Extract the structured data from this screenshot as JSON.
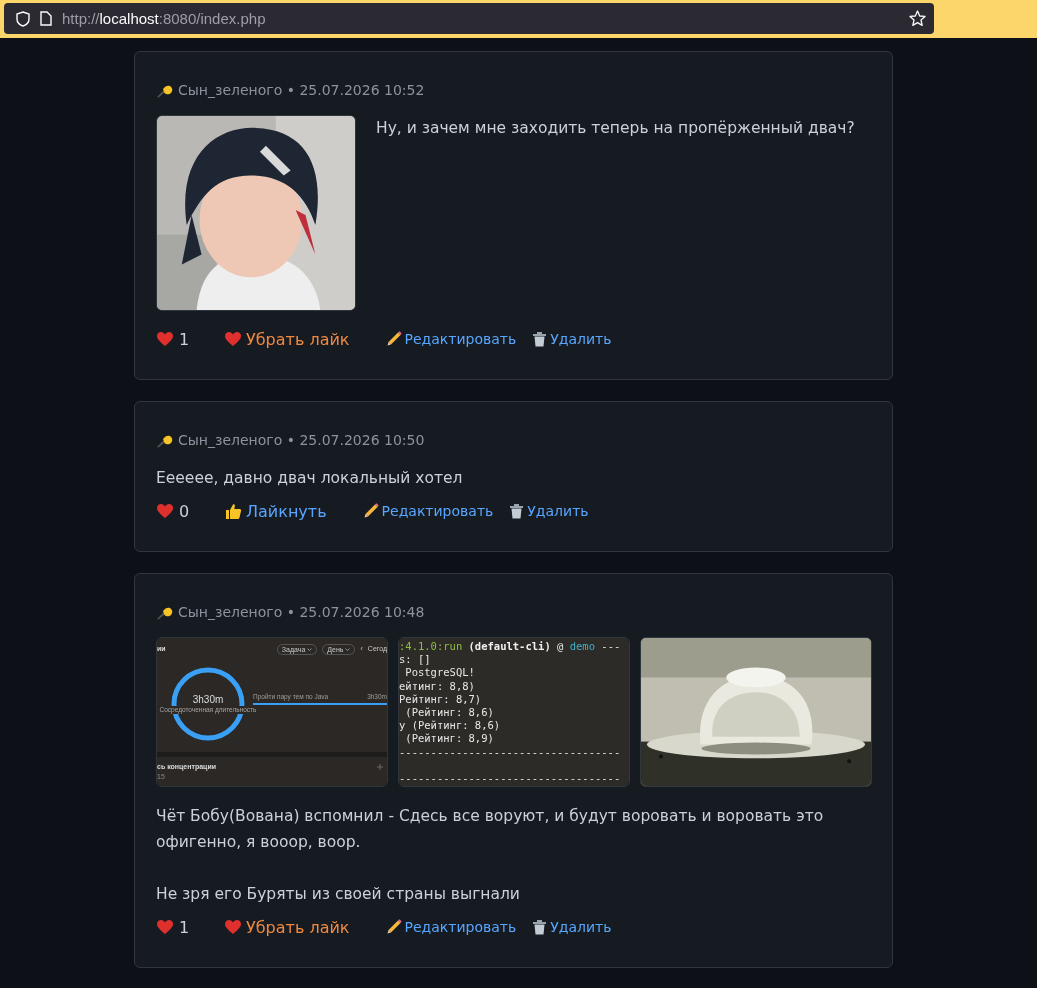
{
  "browser": {
    "url_scheme": "http://",
    "url_host": "localhost",
    "url_rest": ":8080/index.php"
  },
  "posts": [
    {
      "meta": "Сын_зеленого • 25.07.2026 10:52",
      "media": [
        {
          "kind": "picture"
        }
      ],
      "paragraphs": [
        "Ну, и зачем мне заходить теперь на пропёрженный двач?"
      ],
      "likes": "1",
      "liked": true,
      "like_label": "Убрать лайк",
      "edit_label": "Редактировать",
      "delete_label": "Удалить"
    },
    {
      "meta": "Сын_зеленого • 25.07.2026 10:50",
      "paragraphs": [
        "Ееееее, давно двач локальный хотел"
      ],
      "likes": "0",
      "liked": false,
      "like_label": "Лайкнуть",
      "edit_label": "Редактировать",
      "delete_label": "Удалить"
    },
    {
      "meta": "Сын_зеленого • 25.07.2026 10:48",
      "media": [
        {
          "kind": "timer",
          "heading": "ии",
          "chips": [
            "Задача",
            "День"
          ],
          "nav_arrow": "‹",
          "nav": "Сегод",
          "ring_value": "3h30m",
          "ring_caption": "Сосредоточенная длительность",
          "task": "Пройти пару тем по Java",
          "task_time": "3h30m",
          "section": "сь концентрации",
          "footer": "15"
        },
        {
          "kind": "terminal",
          "first_line": [
            {
              "kind": "goal",
              "text": ":4.1.0:run"
            },
            {
              "kind": "bold",
              "text": " (default-cli)"
            },
            {
              "kind": "plain",
              "text": " @ "
            },
            {
              "kind": "project",
              "text": "demo"
            },
            {
              "kind": "plain",
              "text": " ---"
            }
          ],
          "lines": [
            "s: []",
            " PostgreSQL!",
            "ейтинг: 8,8)",
            "Рейтинг: 8,7)",
            " (Рейтинг: 8,6)",
            "у (Рейтинг: 8,6)",
            " (Рейтинг: 8,9)"
          ],
          "rules": [
            "-----------------------------------",
            "-----------------------------------"
          ]
        },
        {
          "kind": "picture"
        }
      ],
      "paragraphs": [
        "Чёт Бобу(Вована) вспомнил - Сдесь все воруют, и будут воровать и воровать это офигенно, я вооор, воор.",
        "Не зря его Буряты из своей страны выгнали"
      ],
      "likes": "1",
      "liked": true,
      "like_label": "Убрать лайк",
      "edit_label": "Редактировать",
      "delete_label": "Удалить"
    }
  ]
}
